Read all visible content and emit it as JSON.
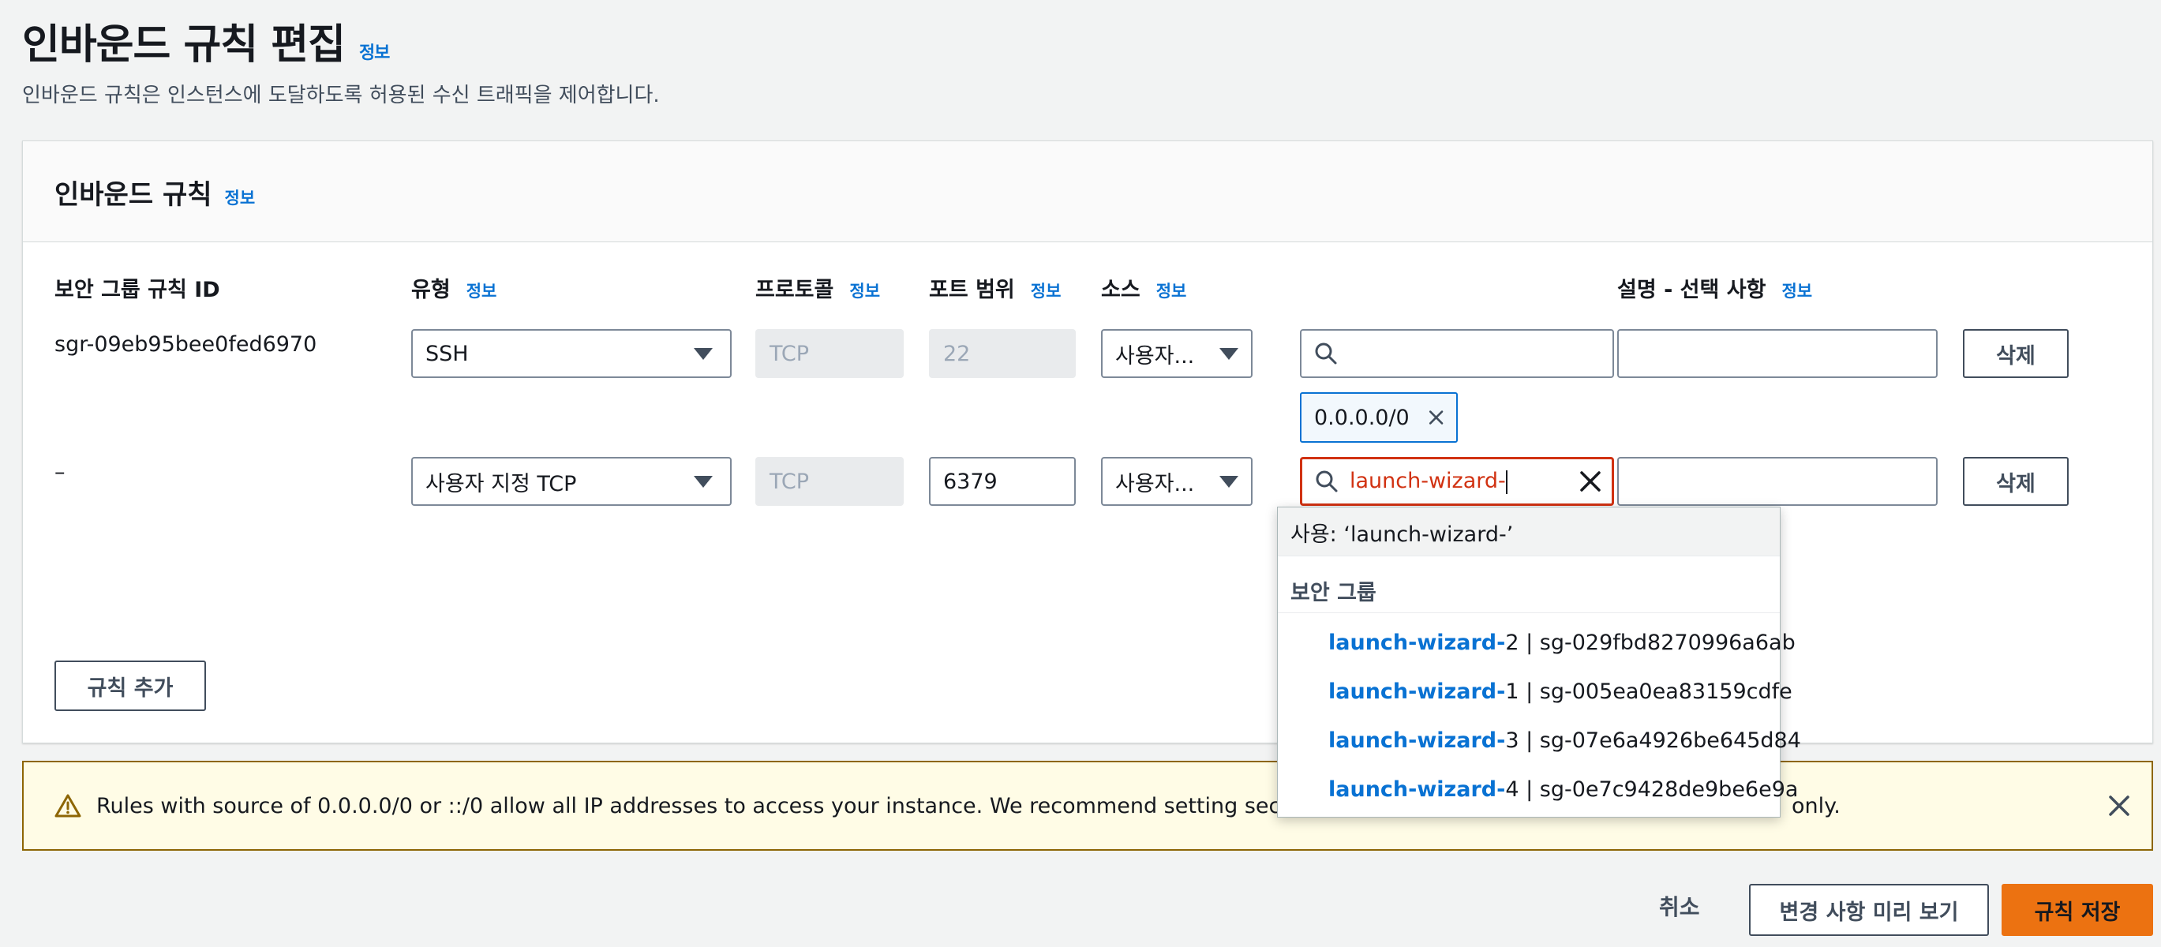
{
  "page": {
    "title": "인바운드 규칙 편집",
    "title_info": "정보",
    "description": "인바운드 규칙은 인스턴스에 도달하도록 허용된 수신 트래픽을 제어합니다."
  },
  "panel": {
    "title": "인바운드 규칙",
    "title_info": "정보",
    "columns": {
      "rule_id": "보안 그룹 규칙 ID",
      "type": "유형",
      "type_info": "정보",
      "protocol": "프로토콜",
      "protocol_info": "정보",
      "port_range": "포트 범위",
      "port_info": "정보",
      "source": "소스",
      "source_info": "정보",
      "description": "설명 - 선택 사항",
      "description_info": "정보"
    },
    "rows": [
      {
        "rule_id": "sgr-09eb95bee0fed6970",
        "type": "SSH",
        "protocol": "TCP",
        "port": "22",
        "source_mode": "사용자...",
        "source_search": "",
        "token": "0.0.0.0/0",
        "description": "",
        "delete_label": "삭제"
      },
      {
        "rule_id": "–",
        "type": "사용자 지정 TCP",
        "protocol": "TCP",
        "port": "6379",
        "source_mode": "사용자...",
        "source_search": "launch-wizard-",
        "description": "",
        "delete_label": "삭제"
      }
    ],
    "add_rule_label": "규칙 추가"
  },
  "dropdown": {
    "use_option": "사용: ‘launch-wizard-’",
    "group_label": "보안 그룹",
    "items": [
      {
        "match": "launch-wizard-",
        "rest": "2 | sg-029fbd8270996a6ab"
      },
      {
        "match": "launch-wizard-",
        "rest": "1 | sg-005ea0ea83159cdfe"
      },
      {
        "match": "launch-wizard-",
        "rest": "3 | sg-07e6a4926be645d84"
      },
      {
        "match": "launch-wizard-",
        "rest": "4 | sg-0e7c9428de9be6e9a"
      }
    ]
  },
  "warning": {
    "text_left": "Rules with source of 0.0.0.0/0 or ::/0 allow all IP addresses to access your instance. We recommend setting security gro",
    "text_right": "only."
  },
  "footer": {
    "cancel_label": "취소",
    "preview_label": "변경 사항 미리 보기",
    "save_label": "규칙 저장"
  },
  "colors": {
    "accent": "#0972d3",
    "error": "#d13212",
    "primary_button": "#ec7211",
    "warning_bg": "#fffce6",
    "warning_border": "#8d6605"
  },
  "icons": [
    "search-icon",
    "clear-icon",
    "remove-token-icon",
    "warning-icon",
    "close-icon",
    "chevron-down-icon"
  ]
}
